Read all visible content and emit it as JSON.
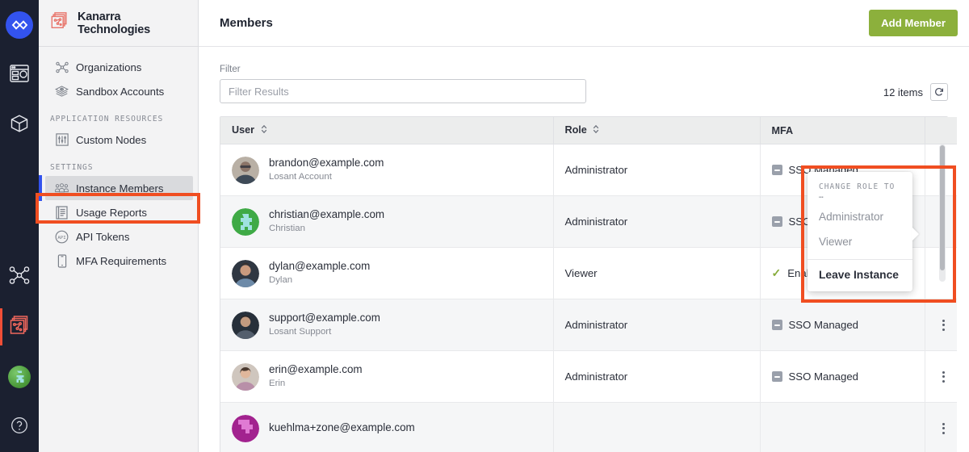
{
  "rail": {
    "items": [
      {
        "name": "losant-logo",
        "icon": "infinity-logo-icon",
        "active": false
      },
      {
        "name": "dashboards",
        "icon": "dashboard-icon",
        "active": false
      },
      {
        "name": "packages",
        "icon": "cube-icon",
        "active": false
      },
      {
        "name": "organizations",
        "icon": "nodes-icon",
        "active": false
      },
      {
        "name": "instance",
        "icon": "stacked-cards-icon",
        "active": true
      },
      {
        "name": "user-avatar",
        "icon": "globe-avatar-icon",
        "active": false
      },
      {
        "name": "help",
        "icon": "question-circle-icon",
        "active": false
      }
    ]
  },
  "brand": {
    "icon": "stacked-cards-icon",
    "name": "Kanarra Technologies"
  },
  "sidebar": {
    "items": [
      {
        "label": "Organizations",
        "icon": "nodes-icon",
        "active": false
      },
      {
        "label": "Sandbox Accounts",
        "icon": "layers-eye-icon",
        "active": false
      }
    ],
    "groups": [
      {
        "title": "APPLICATION RESOURCES",
        "items": [
          {
            "label": "Custom Nodes",
            "icon": "sliders-icon",
            "active": false
          }
        ]
      },
      {
        "title": "SETTINGS",
        "items": [
          {
            "label": "Instance Members",
            "icon": "people-icon",
            "active": true
          },
          {
            "label": "Usage Reports",
            "icon": "report-icon",
            "active": false
          },
          {
            "label": "API Tokens",
            "icon": "api-circle-icon",
            "active": false
          },
          {
            "label": "MFA Requirements",
            "icon": "mobile-icon",
            "active": false
          }
        ]
      }
    ]
  },
  "header": {
    "title": "Members",
    "add_button": "Add Member"
  },
  "filter": {
    "label": "Filter",
    "placeholder": "Filter Results",
    "value": ""
  },
  "toolbar": {
    "count": "12 items",
    "refresh_icon": "refresh-icon"
  },
  "table": {
    "columns": [
      {
        "key": "user",
        "label": "User",
        "sortable": true
      },
      {
        "key": "role",
        "label": "Role",
        "sortable": true
      },
      {
        "key": "mfa",
        "label": "MFA",
        "sortable": false
      },
      {
        "key": "actions",
        "label": "",
        "sortable": false
      }
    ],
    "rows": [
      {
        "email": "brandon@example.com",
        "name": "Losant Account",
        "role": "Administrator",
        "mfa": "SSO Managed",
        "mfa_state": "sso",
        "avatar": "photo-brandon",
        "avatar_color": "#8b7468"
      },
      {
        "email": "christian@example.com",
        "name": "Christian",
        "role": "Administrator",
        "mfa": "SSO Managed",
        "mfa_state": "sso",
        "avatar": "identicon-christian",
        "avatar_color": "#3faa46"
      },
      {
        "email": "dylan@example.com",
        "name": "Dylan",
        "role": "Viewer",
        "mfa": "Enabled",
        "mfa_state": "enabled",
        "avatar": "photo-dylan",
        "avatar_color": "#4a5261"
      },
      {
        "email": "support@example.com",
        "name": "Losant Support",
        "role": "Administrator",
        "mfa": "SSO Managed",
        "mfa_state": "sso",
        "avatar": "photo-support",
        "avatar_color": "#53606f"
      },
      {
        "email": "erin@example.com",
        "name": "Erin",
        "role": "Administrator",
        "mfa": "SSO Managed",
        "mfa_state": "sso",
        "avatar": "photo-erin",
        "avatar_color": "#9a8b84"
      },
      {
        "email": "kuehlma+zone@example.com",
        "name": "",
        "role": "",
        "mfa": "",
        "mfa_state": "none",
        "avatar": "identicon-kuehlma",
        "avatar_color": "#a2238f"
      }
    ]
  },
  "dropdown": {
    "header": "CHANGE ROLE TO …",
    "options": [
      {
        "label": "Administrator"
      },
      {
        "label": "Viewer"
      }
    ],
    "action": "Leave Instance"
  },
  "colors": {
    "accent_blue": "#3353ee",
    "accent_green": "#8cb03c",
    "annotation_red": "#f04e21",
    "rail_bg": "#1b2030",
    "sidebar_bg": "#f3f3f4",
    "brand_red": "#e8756b"
  }
}
